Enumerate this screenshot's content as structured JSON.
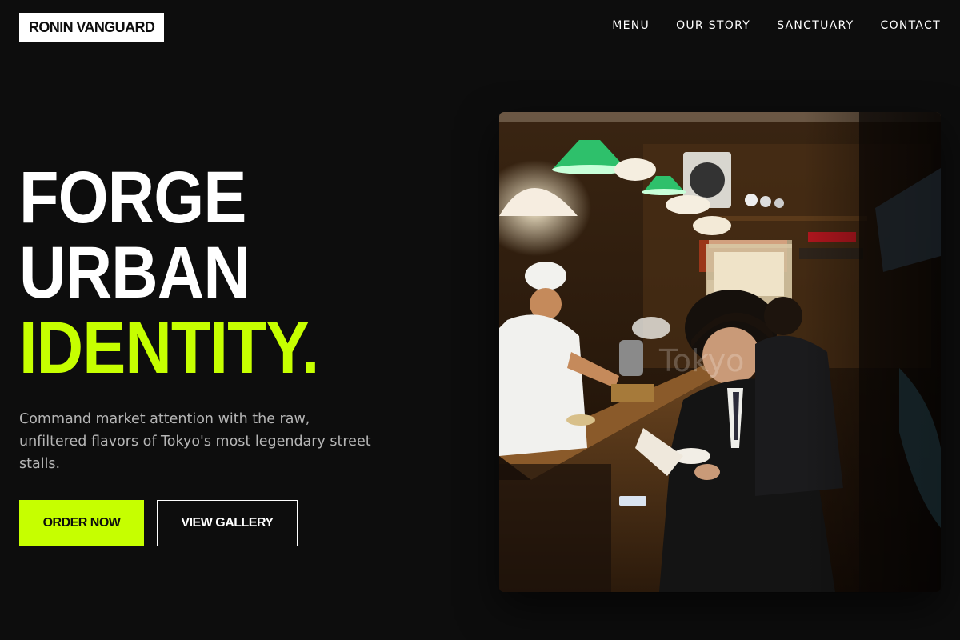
{
  "brand": {
    "logo": "RONIN VANGUARD"
  },
  "nav": {
    "items": [
      {
        "label": "MENU"
      },
      {
        "label": "OUR STORY"
      },
      {
        "label": "SANCTUARY"
      },
      {
        "label": "CONTACT"
      }
    ]
  },
  "hero": {
    "title_lines": [
      "FORGE",
      "URBAN",
      "IDENTITY."
    ],
    "subtitle": "Command market attention with the raw, unfiltered flavors of Tokyo's most legendary street stalls.",
    "primary_button": "ORDER NOW",
    "secondary_button": "VIEW GALLERY",
    "image_watermark": "Tokyo"
  },
  "colors": {
    "background": "#0d0d0d",
    "accent": "#c6ff00",
    "text": "#ffffff",
    "muted_text": "#b5b5b5"
  }
}
